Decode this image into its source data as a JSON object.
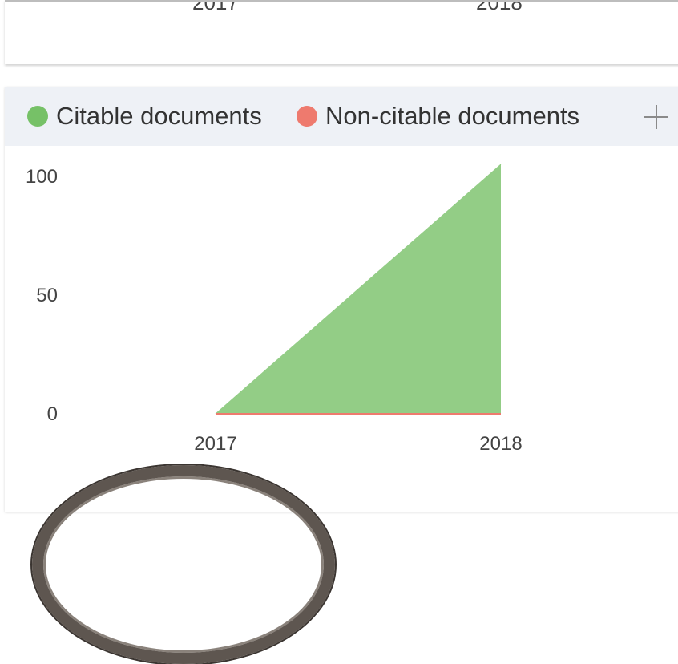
{
  "top_panel": {
    "x_tick_labels": [
      "2017",
      "2018"
    ]
  },
  "legend": {
    "items": [
      {
        "label": "Citable documents",
        "color": "#76c167"
      },
      {
        "label": "Non-citable documents",
        "color": "#ee7a6e"
      }
    ],
    "expand_icon": "plus-icon"
  },
  "chart_data": {
    "type": "area",
    "x": [
      "2017",
      "2018"
    ],
    "series": [
      {
        "name": "Citable documents",
        "values": [
          0,
          105
        ],
        "color": "#93cd86"
      },
      {
        "name": "Non-citable documents",
        "values": [
          0,
          0
        ],
        "color": "#ee7a6e"
      }
    ],
    "y_ticks": [
      0,
      50,
      100
    ],
    "ylim": [
      0,
      105
    ],
    "grid": false,
    "legend_position": "top"
  }
}
